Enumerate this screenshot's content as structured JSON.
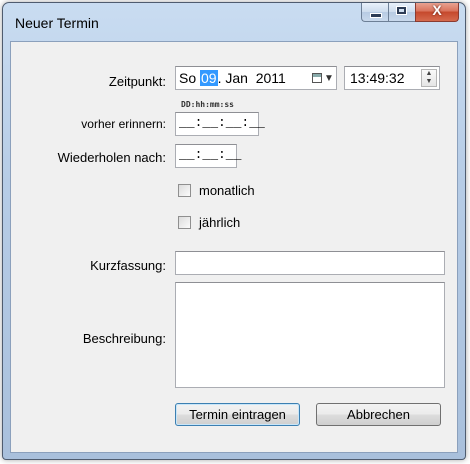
{
  "window": {
    "title": "Neuer Termin",
    "controls": {
      "minimize": "minimize",
      "maximize": "maximize",
      "close": "X"
    }
  },
  "form": {
    "zeitpunkt_label": "Zeitpunkt:",
    "date": {
      "weekday": "So",
      "day": "09",
      "rest": ". Jan  2011"
    },
    "time_value": "13:49:32",
    "format_hint": "DD:hh:mm:ss",
    "vorher_label": "vorher erinnern:",
    "vorher_value": "__:__:__:__",
    "wiederholen_label": "Wiederholen nach:",
    "wiederholen_value": "__:__:__",
    "monatlich_label": "monatlich",
    "monatlich_checked": false,
    "jaehrlich_label": "jährlich",
    "jaehrlich_checked": false,
    "kurzfassung_label": "Kurzfassung:",
    "kurzfassung_value": "",
    "beschreibung_label": "Beschreibung:",
    "beschreibung_value": ""
  },
  "buttons": {
    "submit_label": "Termin eintragen",
    "cancel_label": "Abbrechen"
  },
  "colors": {
    "selection": "#3399ff",
    "dialog_background": "#f0f0f0",
    "close_button": "#c5482c"
  }
}
